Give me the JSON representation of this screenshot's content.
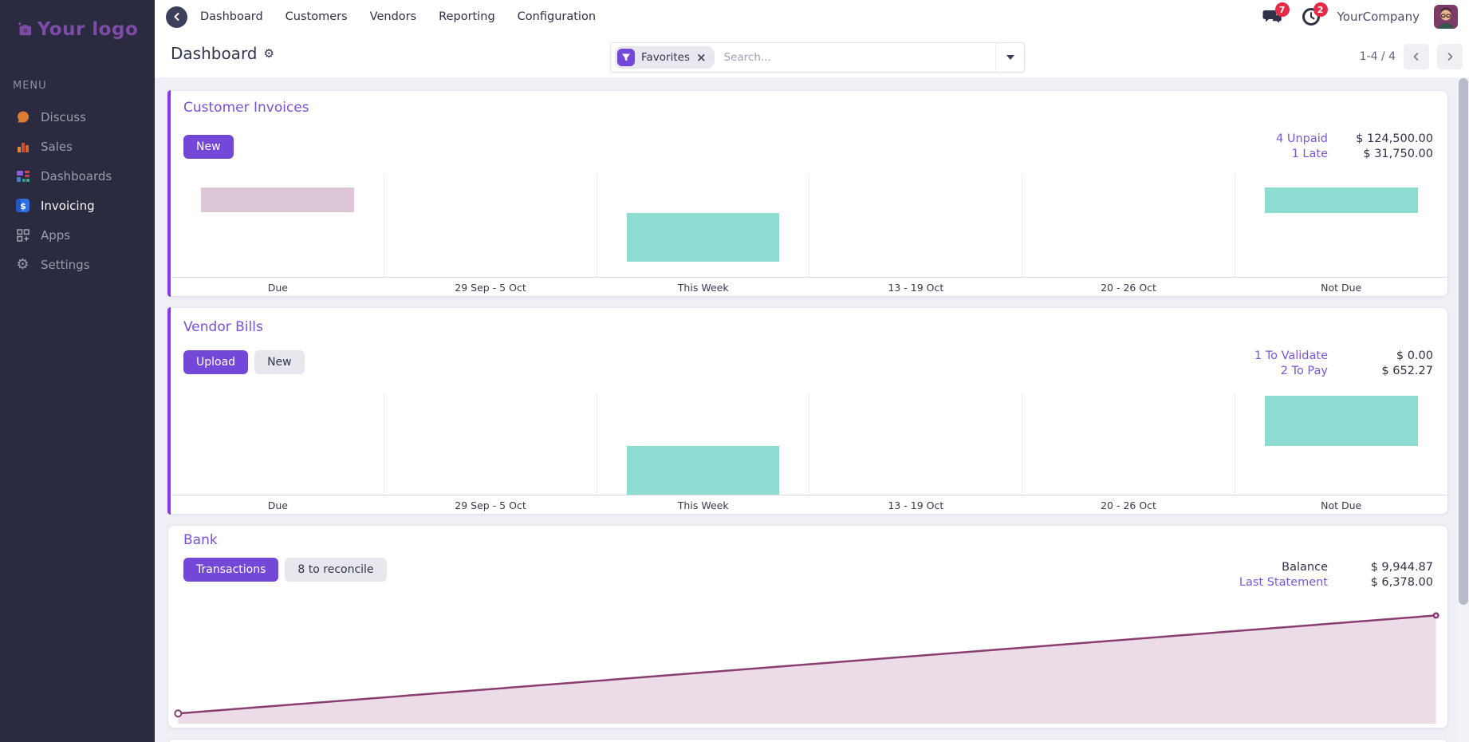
{
  "brand": {
    "logo_text": "Your logo"
  },
  "sidebar": {
    "menu_label": "MENU",
    "items": [
      {
        "label": "Discuss",
        "icon": "discuss-icon",
        "active": false
      },
      {
        "label": "Sales",
        "icon": "sales-icon",
        "active": false
      },
      {
        "label": "Dashboards",
        "icon": "dashboards-icon",
        "active": false
      },
      {
        "label": "Invoicing",
        "icon": "invoicing-icon",
        "active": true
      },
      {
        "label": "Apps",
        "icon": "apps-icon",
        "active": false
      },
      {
        "label": "Settings",
        "icon": "settings-icon",
        "active": false
      }
    ]
  },
  "navbar": {
    "items": [
      "Dashboard",
      "Customers",
      "Vendors",
      "Reporting",
      "Configuration"
    ],
    "badges": {
      "messages": "7",
      "activities": "2"
    },
    "company": "YourCompany"
  },
  "control_panel": {
    "title": "Dashboard",
    "filter_chip": "Favorites",
    "search_placeholder": "Search...",
    "pager": {
      "display": "1-4 / 4"
    }
  },
  "cards": [
    {
      "title": "Customer Invoices",
      "buttons": [
        {
          "label": "New",
          "style": "primary"
        }
      ],
      "stats": [
        {
          "label": "4 Unpaid",
          "amount": "$ 124,500.00",
          "link": true
        },
        {
          "label": "1 Late",
          "amount": "$ 31,750.00",
          "link": true
        }
      ]
    },
    {
      "title": "Vendor Bills",
      "buttons": [
        {
          "label": "Upload",
          "style": "primary"
        },
        {
          "label": "New",
          "style": "secondary"
        }
      ],
      "stats": [
        {
          "label": "1 To Validate",
          "amount": "$ 0.00",
          "link": true
        },
        {
          "label": "2 To Pay",
          "amount": "$ 652.27",
          "link": true
        }
      ]
    },
    {
      "title": "Bank",
      "buttons": [
        {
          "label": "Transactions",
          "style": "primary"
        },
        {
          "label": "8 to reconcile",
          "style": "secondary"
        }
      ],
      "stats": [
        {
          "label": "Balance",
          "amount": "$ 9,944.87",
          "link": false
        },
        {
          "label": "Last Statement",
          "amount": "$ 6,378.00",
          "link": true
        }
      ]
    }
  ],
  "chart_data": [
    {
      "id": "customer-invoices-graph",
      "type": "bar",
      "title": "Customer Invoices",
      "categories": [
        "Due",
        "29 Sep - 5 Oct",
        "This Week",
        "13 - 19 Oct",
        "20 - 26 Oct",
        "Not Due"
      ],
      "y_axis": "amount (unlabeled)",
      "note": "floating bars, heights/offsets estimated as % of plot height",
      "bars": [
        {
          "category": "Due",
          "color": "#ddc6d5",
          "top_pct": 13,
          "height_pct": 24
        },
        {
          "category": "This Week",
          "color": "#8edbd2",
          "top_pct": 38,
          "height_pct": 47
        },
        {
          "category": "Not Due",
          "color": "#8edbd2",
          "top_pct": 13,
          "height_pct": 25
        }
      ]
    },
    {
      "id": "vendor-bills-graph",
      "type": "bar",
      "title": "Vendor Bills",
      "categories": [
        "Due",
        "29 Sep - 5 Oct",
        "This Week",
        "13 - 19 Oct",
        "20 - 26 Oct",
        "Not Due"
      ],
      "y_axis": "amount (unlabeled)",
      "note": "floating bars, heights/offsets estimated as % of plot height",
      "bars": [
        {
          "category": "This Week",
          "color": "#8edbd2",
          "top_pct": 52,
          "height_pct": 48
        },
        {
          "category": "Not Due",
          "color": "#8edbd2",
          "top_pct": 2,
          "height_pct": 50
        }
      ]
    },
    {
      "id": "bank-graph",
      "type": "area",
      "title": "Bank balance trend",
      "line_color": "#8a3d71",
      "fill_color": "#ecdce8",
      "note": "single rising segment, axes unlabeled; y_pct measured from plot top",
      "points": [
        {
          "x_pct": 0.4,
          "y_pct": 91,
          "marker": "hollow"
        },
        {
          "x_pct": 99.6,
          "y_pct": 4.5,
          "marker": "filled"
        }
      ]
    }
  ],
  "colors": {
    "accent": "#7347d8",
    "card_stripe": "#8f35ea",
    "teal_bar": "#8edbd2",
    "pink_bar": "#ddc6d5",
    "bank_line": "#8a3d71",
    "bank_fill": "#ecdce8",
    "badge_red": "#e52b47",
    "sidebar_bg": "#2a2a40"
  }
}
